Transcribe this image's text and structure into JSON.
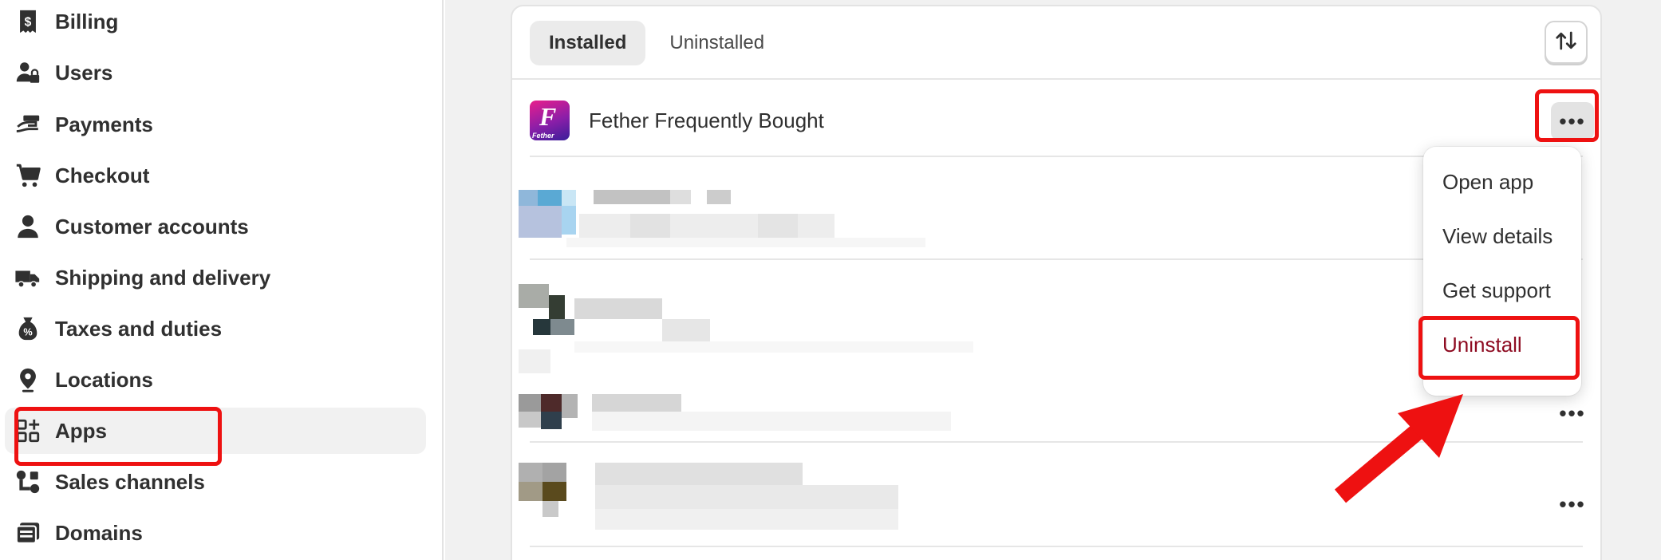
{
  "sidebar": {
    "items": [
      {
        "label": "Billing",
        "icon": "billing-icon"
      },
      {
        "label": "Users",
        "icon": "users-icon"
      },
      {
        "label": "Payments",
        "icon": "payments-icon"
      },
      {
        "label": "Checkout",
        "icon": "cart-icon"
      },
      {
        "label": "Customer accounts",
        "icon": "person-icon"
      },
      {
        "label": "Shipping and delivery",
        "icon": "truck-icon"
      },
      {
        "label": "Taxes and duties",
        "icon": "tax-icon"
      },
      {
        "label": "Locations",
        "icon": "location-pin-icon"
      },
      {
        "label": "Apps",
        "icon": "apps-grid-icon",
        "active": true
      },
      {
        "label": "Sales channels",
        "icon": "sales-channels-icon"
      },
      {
        "label": "Domains",
        "icon": "domains-icon"
      }
    ]
  },
  "apps_card": {
    "tabs": [
      {
        "label": "Installed",
        "active": true
      },
      {
        "label": "Uninstalled",
        "active": false
      }
    ],
    "sort_icon": "sort-arrows-icon",
    "first_app": {
      "name": "Fether Frequently Bought",
      "logo_letter": "F",
      "logo_text": "Fether"
    },
    "more_icon": "ellipsis-icon",
    "more_glyph": "•••"
  },
  "dropdown": {
    "items": [
      {
        "label": "Open app"
      },
      {
        "label": "View details"
      },
      {
        "label": "Get support"
      },
      {
        "label": "Uninstall",
        "destructive": true
      }
    ]
  },
  "colors": {
    "annotation_red": "#ee1111",
    "destructive_text": "#8e0b21",
    "active_nav_bg": "#f1f1f1"
  }
}
